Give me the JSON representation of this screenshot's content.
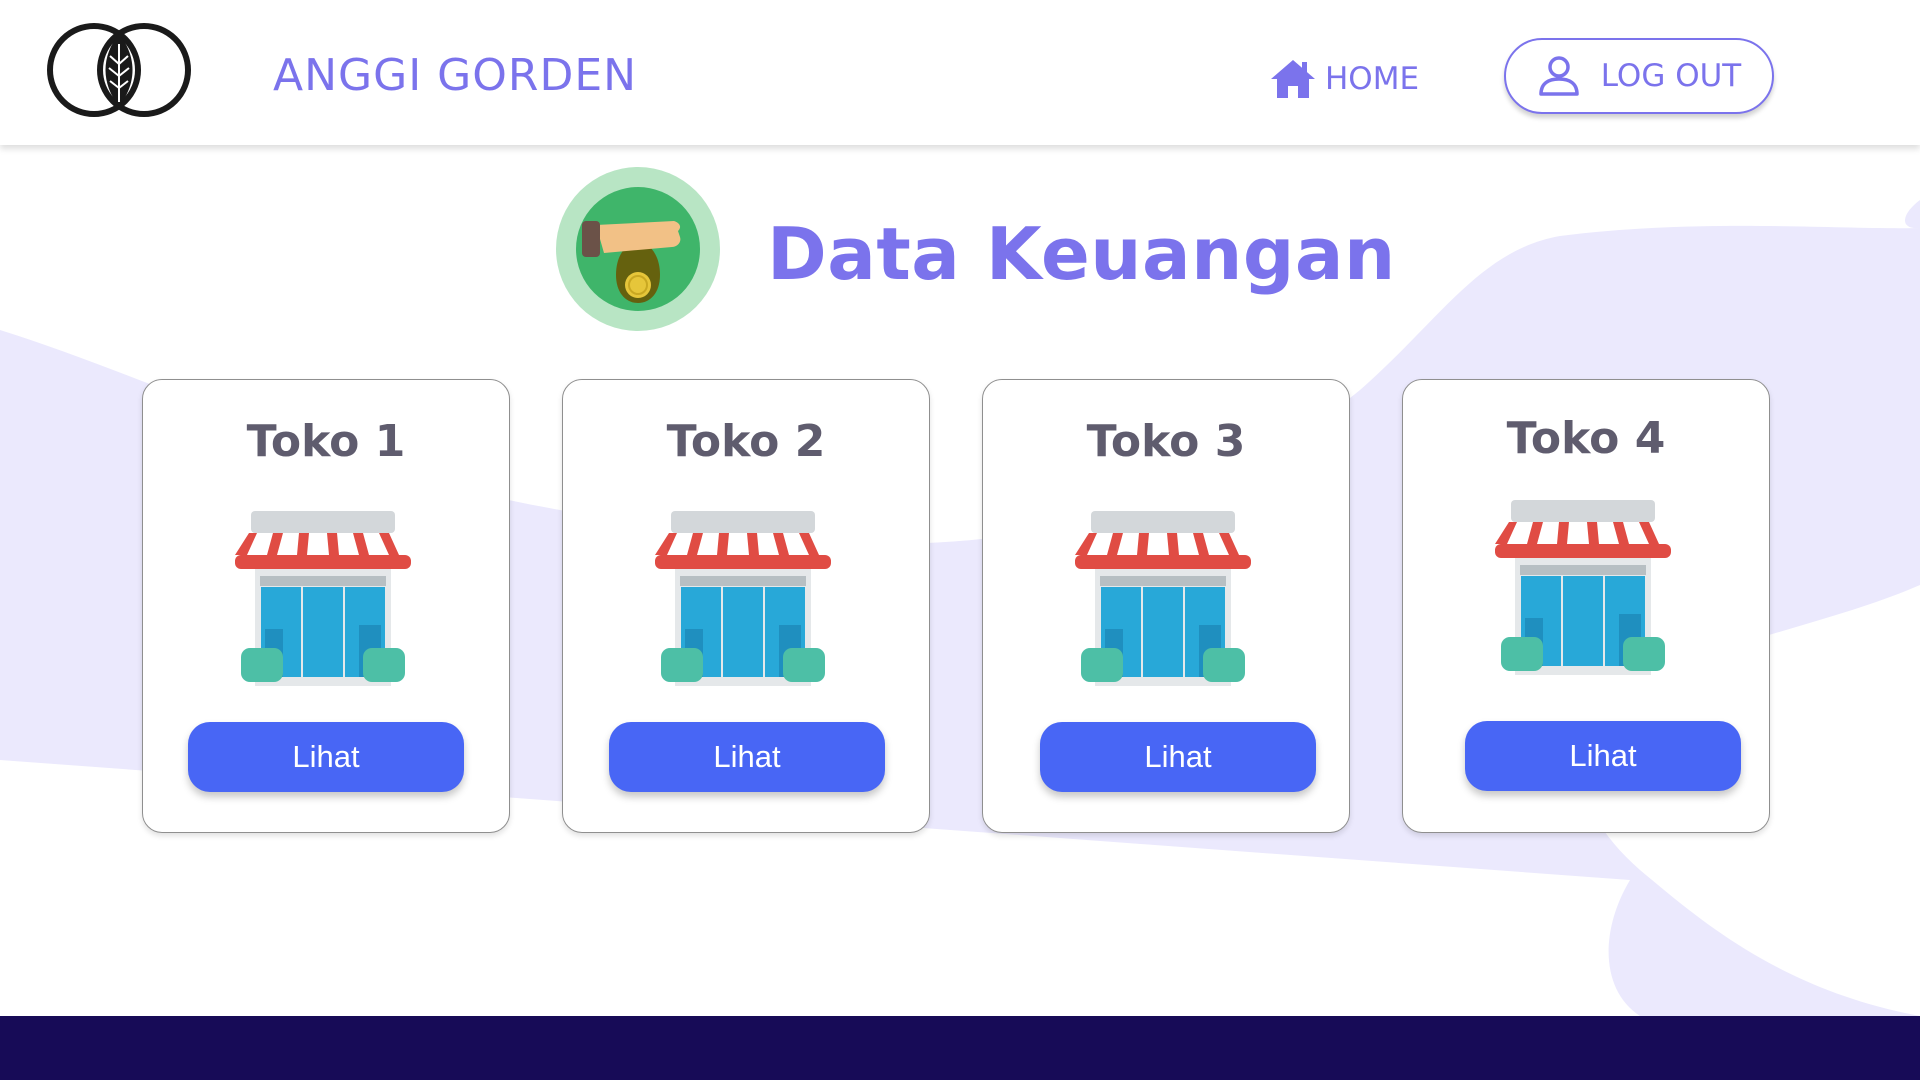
{
  "header": {
    "brand": "ANGGI GORDEN",
    "nav_home_label": "HOME",
    "logout_label": "LOG OUT"
  },
  "main": {
    "title": "Data Keuangan",
    "title_icon": "money-bag-hand-icon",
    "cards": [
      {
        "title": "Toko 1",
        "button_label": "Lihat",
        "icon": "store-icon"
      },
      {
        "title": "Toko 2",
        "button_label": "Lihat",
        "icon": "store-icon"
      },
      {
        "title": "Toko 3",
        "button_label": "Lihat",
        "icon": "store-icon"
      },
      {
        "title": "Toko 4",
        "button_label": "Lihat",
        "icon": "store-icon"
      }
    ]
  },
  "colors": {
    "accent": "#7b73ec",
    "button": "#4866f5",
    "footer": "#170b57",
    "blob": "#ebe9fd"
  }
}
